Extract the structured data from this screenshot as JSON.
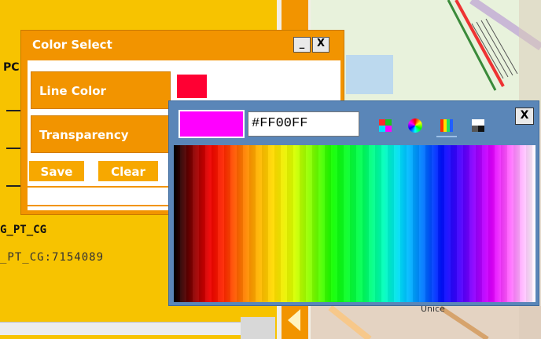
{
  "sidebar": {
    "fragment_left": "PC",
    "fragment_bold": "G_PT_CG",
    "fragment_id": "_PT_CG:7154089"
  },
  "dialog": {
    "title": "Color Select",
    "minimize_label": "_",
    "close_label": "X",
    "line_color_label": "Line Color",
    "line_color_value": "#FF0033",
    "transparency_label": "Transparency",
    "save_label": "Save",
    "clear_label": "Clear"
  },
  "picker": {
    "hex_value": "#FF00FF",
    "preview_color": "#FF00FF",
    "close_label": "X",
    "tools": [
      "swatches-icon",
      "color-wheel-icon",
      "spectrum-icon",
      "grayscale-icon"
    ],
    "active_tool": "spectrum-icon"
  },
  "map": {
    "label": "Unice"
  }
}
